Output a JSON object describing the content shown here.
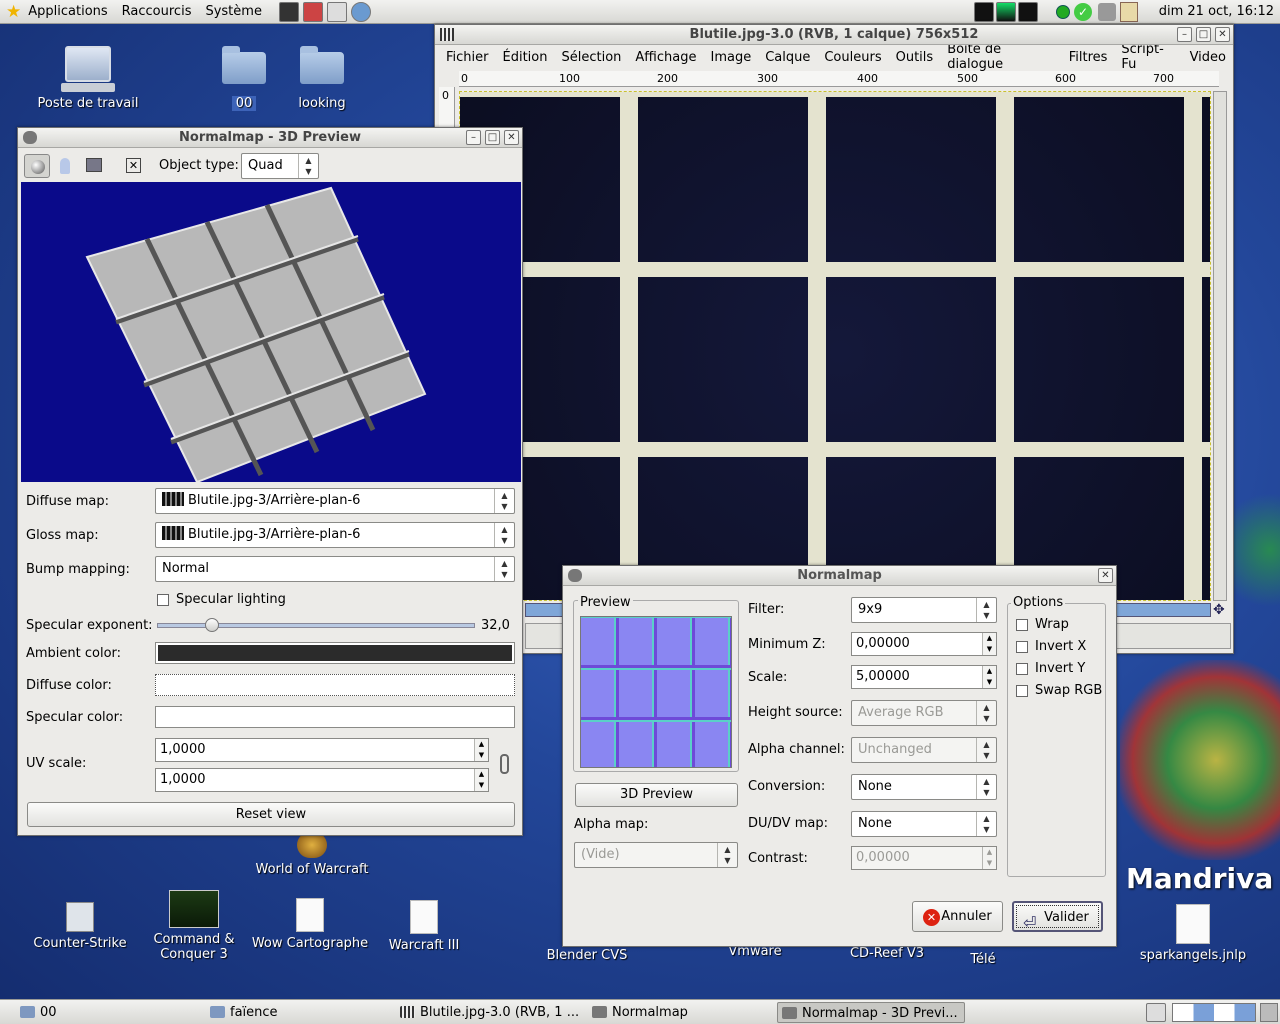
{
  "top_panel": {
    "menus": [
      "Applications",
      "Raccourcis",
      "Système"
    ],
    "clock": "dim 21 oct, 16:12"
  },
  "desktop_icons": [
    {
      "label": "Poste de travail",
      "icon": "computer-icon"
    },
    {
      "label": "00",
      "icon": "folder-icon"
    },
    {
      "label": "looking",
      "icon": "folder-icon"
    },
    {
      "label": "World of Warcraft",
      "icon": "wow-icon"
    },
    {
      "label": "Counter-Strike",
      "icon": "cs-icon"
    },
    {
      "label": "Command & Conquer 3",
      "icon": "cnc-icon"
    },
    {
      "label": "Wow Cartographe",
      "icon": "file-icon"
    },
    {
      "label": "Warcraft III",
      "icon": "file-icon"
    },
    {
      "label": "Blender CVS",
      "icon": "blender-icon"
    },
    {
      "label": "Vmware",
      "icon": "vmware-icon"
    },
    {
      "label": "CD-Reef V3",
      "icon": "cd-icon"
    },
    {
      "label": "Télé",
      "icon": "tv-icon"
    },
    {
      "label": "sparkangels.jnlp",
      "icon": "file-icon"
    }
  ],
  "brand": "Mandriva",
  "gimp_window": {
    "title": "Blutile.jpg-3.0 (RVB, 1 calque) 756x512",
    "menu": [
      "Fichier",
      "Édition",
      "Sélection",
      "Affichage",
      "Image",
      "Calque",
      "Couleurs",
      "Outils",
      "Boîte de dialogue",
      "Filtres",
      "Script-Fu",
      "Video"
    ],
    "ruler_marks": [
      "0",
      "100",
      "200",
      "300",
      "400",
      "500",
      "600",
      "700"
    ],
    "vruler": "0"
  },
  "preview_window": {
    "title": "Normalmap - 3D Preview",
    "object_type_label": "Object type:",
    "object_type": "Quad",
    "diffuse_map_label": "Diffuse map:",
    "diffuse_map": "Blutile.jpg-3/Arrière-plan-6",
    "gloss_map_label": "Gloss map:",
    "gloss_map": "Blutile.jpg-3/Arrière-plan-6",
    "bump_mapping_label": "Bump mapping:",
    "bump_mapping": "Normal",
    "specular_lighting_label": "Specular lighting",
    "specular_exponent_label": "Specular exponent:",
    "specular_exponent": "32,0",
    "specular_exponent_fraction": 0.17,
    "ambient_color_label": "Ambient color:",
    "ambient_color": "#2b2b2b",
    "diffuse_color_label": "Diffuse color:",
    "diffuse_color": "#ffffff",
    "specular_color_label": "Specular color:",
    "specular_color": "#ffffff",
    "uv_scale_label": "UV scale:",
    "uv_scale_u": "1,0000",
    "uv_scale_v": "1,0000",
    "reset_view": "Reset view"
  },
  "normalmap_dialog": {
    "title": "Normalmap",
    "preview_label": "Preview",
    "preview_3d_button": "3D Preview",
    "alpha_map_label": "Alpha map:",
    "alpha_map": "(Vide)",
    "filter_label": "Filter:",
    "filter": "9x9",
    "min_z_label": "Minimum Z:",
    "min_z": "0,00000",
    "scale_label": "Scale:",
    "scale": "5,00000",
    "height_source_label": "Height source:",
    "height_source": "Average RGB",
    "alpha_channel_label": "Alpha channel:",
    "alpha_channel": "Unchanged",
    "conversion_label": "Conversion:",
    "conversion": "None",
    "dudv_label": "DU/DV map:",
    "dudv": "None",
    "contrast_label": "Contrast:",
    "contrast": "0,00000",
    "options_label": "Options",
    "options": [
      "Wrap",
      "Invert X",
      "Invert Y",
      "Swap RGB"
    ],
    "cancel": "Annuler",
    "ok": "Valider"
  },
  "taskbar": [
    {
      "label": "00"
    },
    {
      "label": "faïence"
    },
    {
      "label": "Blutile.jpg-3.0 (RVB, 1 ..."
    },
    {
      "label": "Normalmap"
    },
    {
      "label": "Normalmap - 3D Previ..."
    }
  ]
}
